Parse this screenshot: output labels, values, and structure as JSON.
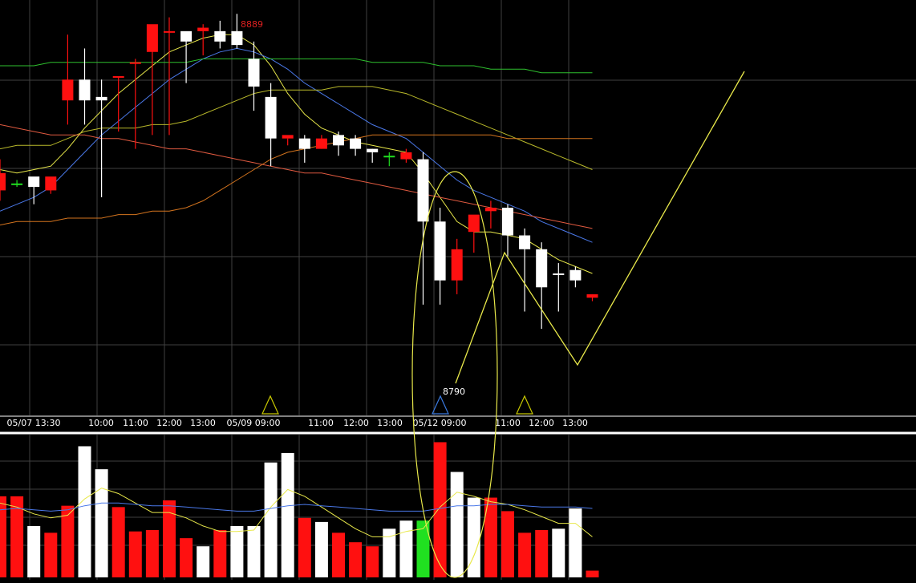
{
  "chart_data": [
    {
      "type": "candlestick",
      "panel": "price",
      "categories": [
        "c0",
        "c1",
        "c2",
        "c3",
        "c4",
        "c5",
        "c6",
        "c7",
        "c8",
        "c9",
        "c10",
        "c11",
        "c12",
        "c13",
        "c14",
        "c15",
        "c16",
        "c17",
        "c18",
        "c19",
        "c20",
        "c21",
        "c22",
        "c23",
        "c24",
        "c25",
        "c26",
        "c27",
        "c28",
        "c29",
        "c30",
        "c31",
        "c32",
        "c33",
        "c34",
        "c35"
      ],
      "ylim": [
        8775,
        8895
      ],
      "ohlc": [
        [
          8845,
          8849,
          8837,
          8840
        ],
        [
          8842,
          8843,
          8841,
          8842
        ],
        [
          8841,
          8843,
          8836,
          8844
        ],
        [
          8840,
          8843,
          8839,
          8844
        ],
        [
          8866,
          8885,
          8859,
          8872
        ],
        [
          8872,
          8881,
          8859,
          8866
        ],
        [
          8867,
          8872,
          8838,
          8866
        ],
        [
          8873,
          8873,
          8857,
          8873
        ],
        [
          8877,
          8878,
          8852,
          8877
        ],
        [
          8880,
          8883,
          8856,
          8888
        ],
        [
          8886,
          8890,
          8856,
          8886
        ],
        [
          8883,
          8885,
          8871,
          8886
        ],
        [
          8886,
          8888,
          8879,
          8887
        ],
        [
          8883,
          8889,
          8881,
          8886
        ],
        [
          8886,
          8891,
          8881,
          8882
        ],
        [
          8878,
          8883,
          8863,
          8870
        ],
        [
          8867,
          8871,
          8847,
          8855
        ],
        [
          8855,
          8855,
          8853,
          8856
        ],
        [
          8855,
          8856,
          8848,
          8852
        ],
        [
          8852,
          8856,
          8852,
          8855
        ],
        [
          8856,
          8857,
          8850,
          8853
        ],
        [
          8855,
          8856,
          8850,
          8852
        ],
        [
          8852,
          8852,
          8848,
          8851
        ],
        [
          8850,
          8851,
          8847,
          8850
        ],
        [
          8849,
          8852,
          8848,
          8851
        ],
        [
          8849,
          8851,
          8807,
          8831
        ],
        [
          8831,
          8835,
          8807,
          8814
        ],
        [
          8823,
          8826,
          8810,
          8814
        ],
        [
          8828,
          8831,
          8822,
          8833
        ],
        [
          8834,
          8837,
          8829,
          8835
        ],
        [
          8835,
          8836,
          8821,
          8827
        ],
        [
          8827,
          8829,
          8805,
          8823
        ],
        [
          8823,
          8825,
          8800,
          8812
        ],
        [
          8816,
          8819,
          8805,
          8816
        ],
        [
          8814,
          8818,
          8812,
          8817
        ],
        [
          8809,
          8810,
          8808,
          8810
        ]
      ],
      "candle_colors": [
        "red",
        "green",
        "white",
        "red",
        "red",
        "white",
        "white",
        "red",
        "red",
        "red",
        "red",
        "white",
        "red",
        "white",
        "white",
        "white",
        "white",
        "red",
        "white",
        "red",
        "white",
        "white",
        "white",
        "green",
        "red",
        "white",
        "white",
        "red",
        "red",
        "red",
        "white",
        "white",
        "white",
        "white",
        "white",
        "red"
      ],
      "moving_averages": [
        {
          "color": "#e8e84a",
          "values": [
            8846,
            8845,
            8846,
            8847,
            8852,
            8858,
            8863,
            8868,
            8872,
            8876,
            8880,
            8882,
            8884,
            8885,
            8885,
            8882,
            8876,
            8868,
            8862,
            8858,
            8856,
            8854,
            8853,
            8852,
            8851,
            8845,
            8838,
            8831,
            8828,
            8828,
            8827,
            8826,
            8823,
            8820,
            8818,
            8816
          ]
        },
        {
          "color": "#4a78e8",
          "values": [
            8834,
            8836,
            8838,
            8841,
            8846,
            8851,
            8856,
            8860,
            8864,
            8868,
            8872,
            8875,
            8878,
            8880,
            8881,
            8880,
            8878,
            8875,
            8871,
            8868,
            8865,
            8862,
            8859,
            8857,
            8855,
            8851,
            8847,
            8843,
            8840,
            8838,
            8836,
            8834,
            8831,
            8829,
            8827,
            8825
          ]
        },
        {
          "color": "#b8b82a",
          "values": [
            8852,
            8853,
            8853,
            8853,
            8855,
            8857,
            8858,
            8858,
            8858,
            8859,
            8859,
            8860,
            8862,
            8864,
            8866,
            8868,
            8869,
            8869,
            8869,
            8869,
            8870,
            8870,
            8870,
            8869,
            8868,
            8866,
            8864,
            8862,
            8860,
            8858,
            8856,
            8854,
            8852,
            8850,
            8848,
            8846
          ]
        },
        {
          "color": "#e05a40",
          "values": [
            8859,
            8858,
            8857,
            8856,
            8856,
            8856,
            8855,
            8855,
            8854,
            8853,
            8852,
            8852,
            8851,
            8850,
            8849,
            8848,
            8847,
            8846,
            8845,
            8845,
            8844,
            8843,
            8842,
            8841,
            8840,
            8839,
            8838,
            8837,
            8836,
            8835,
            8834,
            8833,
            8832,
            8831,
            8830,
            8829
          ]
        },
        {
          "color": "#d4741e",
          "values": [
            8830,
            8831,
            8831,
            8831,
            8832,
            8832,
            8832,
            8833,
            8833,
            8834,
            8834,
            8835,
            8837,
            8840,
            8843,
            8846,
            8849,
            8851,
            8852,
            8853,
            8854,
            8855,
            8856,
            8856,
            8856,
            8856,
            8856,
            8856,
            8856,
            8856,
            8855,
            8855,
            8855,
            8855,
            8855,
            8855
          ]
        },
        {
          "color": "#2ec02e",
          "values": [
            8876,
            8876,
            8876,
            8877,
            8877,
            8877,
            8877,
            8877,
            8877,
            8877,
            8877,
            8877,
            8878,
            8878,
            8878,
            8878,
            8878,
            8878,
            8878,
            8878,
            8878,
            8878,
            8877,
            8877,
            8877,
            8877,
            8876,
            8876,
            8876,
            8875,
            8875,
            8875,
            8874,
            8874,
            8874,
            8874
          ]
        }
      ],
      "x_tick_labels": [
        "05/07 13:30",
        "10:00",
        "11:00",
        "12:00",
        "13:00",
        "05/09 09:00",
        "11:00",
        "12:00",
        "13:00",
        "05/12 09:00",
        "11:00",
        "12:00",
        "13:00"
      ],
      "annotations": {
        "high_label": "8889",
        "low_label": "8790"
      },
      "signal_markers": [
        {
          "color": "#c8c800"
        },
        {
          "color": "#3a7ae0"
        },
        {
          "color": "#c8c800"
        }
      ],
      "grid": true
    },
    {
      "type": "bar",
      "panel": "volume",
      "values": [
        60,
        60,
        38,
        33,
        53,
        97,
        80,
        52,
        34,
        35,
        57,
        29,
        23,
        35,
        38,
        38,
        85,
        92,
        44,
        41,
        33,
        26,
        23,
        36,
        42,
        42,
        100,
        78,
        59,
        59,
        49,
        33,
        35,
        36,
        51,
        5
      ],
      "bar_colors": [
        "red",
        "red",
        "white",
        "red",
        "red",
        "white",
        "white",
        "red",
        "red",
        "red",
        "red",
        "red",
        "white",
        "red",
        "white",
        "white",
        "white",
        "white",
        "red",
        "white",
        "red",
        "red",
        "red",
        "white",
        "white",
        "green",
        "red",
        "white",
        "white",
        "red",
        "red",
        "red",
        "red",
        "white",
        "white",
        "red"
      ],
      "ylim": [
        0,
        105
      ],
      "moving_averages": [
        {
          "color": "#e8e84a",
          "values": [
            55,
            52,
            47,
            44,
            46,
            58,
            66,
            62,
            55,
            48,
            48,
            44,
            38,
            34,
            34,
            35,
            52,
            65,
            60,
            52,
            44,
            36,
            30,
            30,
            34,
            36,
            52,
            63,
            60,
            56,
            54,
            50,
            45,
            40,
            40,
            30
          ]
        },
        {
          "color": "#4a78e8",
          "values": [
            50,
            51,
            50,
            49,
            50,
            53,
            55,
            55,
            54,
            53,
            53,
            52,
            51,
            50,
            49,
            49,
            51,
            53,
            54,
            53,
            52,
            51,
            50,
            49,
            49,
            49,
            51,
            53,
            53,
            54,
            54,
            53,
            52,
            52,
            52,
            51
          ]
        }
      ],
      "grid": true
    }
  ]
}
